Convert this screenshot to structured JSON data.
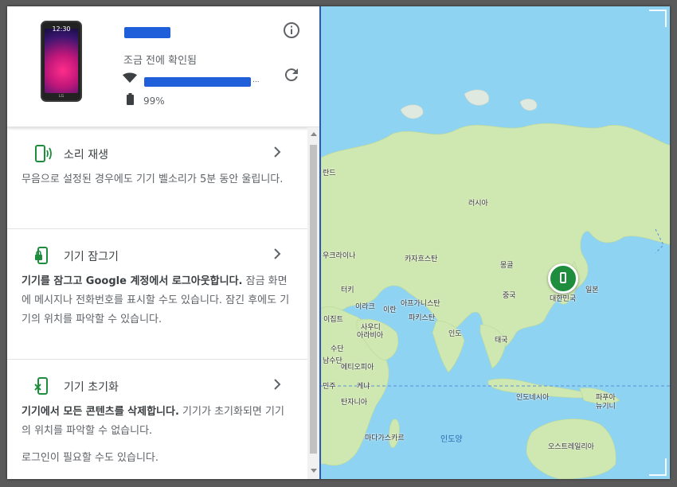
{
  "device": {
    "status": "조금 전에 확인됨",
    "battery": "99%",
    "phone_time": "12:30",
    "phone_brand": "LG"
  },
  "actions": [
    {
      "title": "소리 재생",
      "desc_plain": "무음으로 설정된 경우에도 기기 벨소리가 5분 동안 울립니다."
    },
    {
      "title": "기기 잠그기",
      "desc_bold": "기기를 잠그고 Google 계정에서 로그아웃합니다.",
      "desc_plain": " 잠금 화면에 메시지나 전화번호를 표시할 수도 있습니다. 잠긴 후에도 기기의 위치를 파악할 수 있습니다."
    },
    {
      "title": "기기 초기화",
      "desc_bold": "기기에서 모든 콘텐츠를 삭제합니다.",
      "desc_plain": " 기기가 초기화되면 기기의 위치를 파악할 수 없습니다.",
      "note": "로그인이 필요할 수도 있습니다."
    }
  ],
  "map": {
    "labels": [
      "란드",
      "러시아",
      "우크라이나",
      "카자흐스탄",
      "몽골",
      "터키",
      "이라크",
      "이란",
      "아프가니스탄",
      "파키스탄",
      "중국",
      "대한민국",
      "일본",
      "이집트",
      "사우디",
      "아라비아",
      "인도",
      "태국",
      "수단",
      "에티오피아",
      "케냐",
      "탄자니아",
      "인도네시아",
      "파푸아",
      "뉴기니",
      "마다가스카르",
      "인도양",
      "오스트레일리아",
      "남수단",
      "민주"
    ],
    "colors": {
      "water": "#8fd3f2",
      "land": "#cfe7b0",
      "pin": "#1e8e3e"
    }
  }
}
